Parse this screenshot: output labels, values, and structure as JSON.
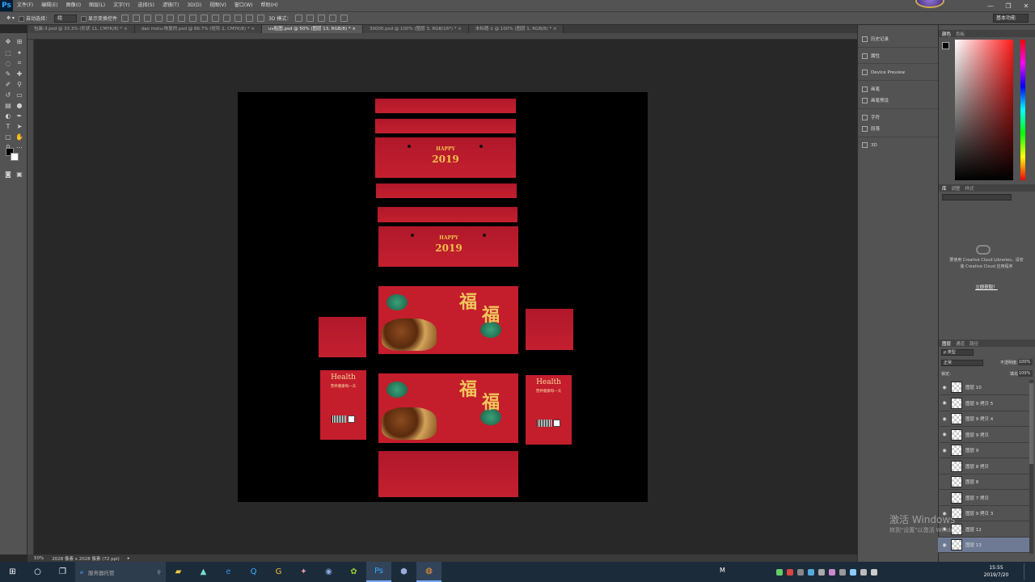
{
  "app": {
    "logo": "Ps",
    "workspace": "基本功能"
  },
  "menu": [
    "文件(F)",
    "编辑(E)",
    "图像(I)",
    "图层(L)",
    "文字(Y)",
    "选择(S)",
    "滤镜(T)",
    "3D(D)",
    "视图(V)",
    "窗口(W)",
    "帮助(H)"
  ],
  "window_controls": {
    "minimize": "—",
    "maximize": "❐",
    "close": "✕"
  },
  "options": {
    "auto_select": "自动选择：",
    "auto_select_value": "组",
    "show_transform": "显示变换控件",
    "mode_3d": "3D 模式："
  },
  "tabs": [
    {
      "label": "包装-3.psd @ 33.3% (形状 11, CMYK/8) *",
      "active": false
    },
    {
      "label": "dao motu-恢复的.psd @ 66.7% (矩形 2, CMYK/8) *",
      "active": false
    },
    {
      "label": "uv贴图.psd @ 50% (图层 13, RGB/8) *",
      "active": true
    },
    {
      "label": "30000.psd @ 100% (图层 3, RGB/16*) *",
      "active": false
    },
    {
      "label": "未标题-1 @ 100% (图层 1, RGB/8) *",
      "active": false
    }
  ],
  "status": {
    "zoom": "50%",
    "doc_size": "2028 像素 x 2028 像素 (72 ppi)"
  },
  "artwork": {
    "happy": "HAPPY",
    "year": "2019",
    "fu": "福",
    "health": "Health",
    "health_sub": "营养健康每一天"
  },
  "dock": [
    {
      "label": "历史记录",
      "icon": "history-icon"
    },
    {
      "label": "属性",
      "icon": "properties-icon"
    },
    {
      "label": "Device Preview",
      "icon": "device-preview-icon"
    },
    {
      "label": "画笔",
      "icon": "brush-icon"
    },
    {
      "label": "画笔预设",
      "icon": "brush-presets-icon"
    },
    {
      "label": "字符",
      "icon": "character-icon"
    },
    {
      "label": "段落",
      "icon": "paragraph-icon"
    },
    {
      "label": "3D",
      "icon": "3d-icon"
    }
  ],
  "color_panel": {
    "tabs": [
      "颜色",
      "色板"
    ],
    "fg": "#000000"
  },
  "library_panel": {
    "tabs": [
      "库",
      "调整",
      "样式"
    ],
    "message": "要使用 Creative Cloud Libraries，请安装 Creative Cloud 应用程序",
    "link": "立即获取！"
  },
  "layers_panel": {
    "tabs": [
      "图层",
      "通道",
      "路径"
    ],
    "kind": "ρ 类型",
    "blend": "正常",
    "opacity_label": "不透明度:",
    "opacity": "100%",
    "lock_label": "锁定:",
    "fill_label": "填充:",
    "fill": "100%",
    "layers": [
      {
        "name": "图层 10",
        "visible": true,
        "selected": false
      },
      {
        "name": "图层 9 拷贝 5",
        "visible": true,
        "selected": false
      },
      {
        "name": "图层 9 拷贝 4",
        "visible": true,
        "selected": false
      },
      {
        "name": "图层 9 拷贝",
        "visible": true,
        "selected": false
      },
      {
        "name": "图层 9",
        "visible": true,
        "selected": false
      },
      {
        "name": "图层 8 拷贝",
        "visible": false,
        "selected": false
      },
      {
        "name": "图层 8",
        "visible": false,
        "selected": false
      },
      {
        "name": "图层 7 拷贝",
        "visible": false,
        "selected": false
      },
      {
        "name": "图层 9 拷贝 3",
        "visible": true,
        "selected": false
      },
      {
        "name": "图层 12",
        "visible": true,
        "selected": false
      },
      {
        "name": "图层 13",
        "visible": true,
        "selected": true
      }
    ]
  },
  "watermark": {
    "line1": "激活 Windows",
    "line2": "转到\"设置\"以激活 Windows。"
  },
  "taskbar": {
    "search_placeholder": "服务器托管",
    "time": "15:55",
    "date": "2019/7/20",
    "ime": "M"
  }
}
